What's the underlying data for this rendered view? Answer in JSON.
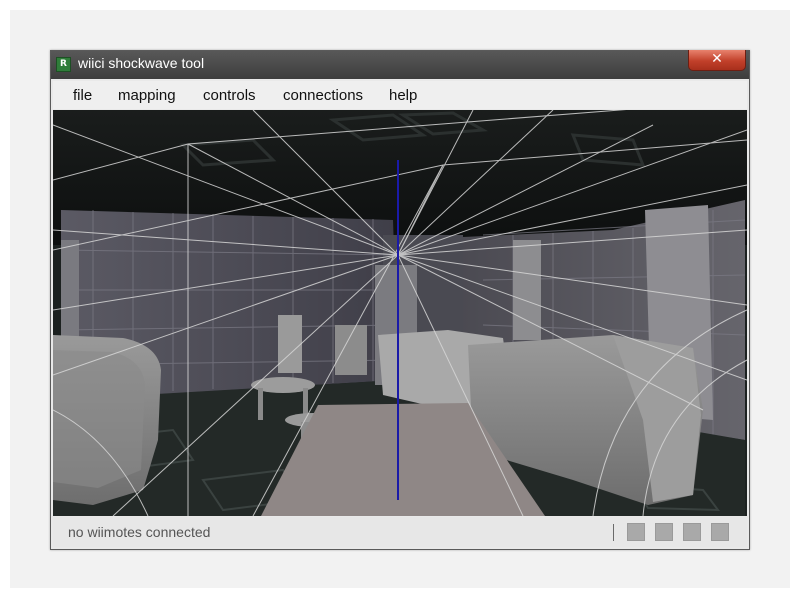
{
  "window": {
    "title": "wiici shockwave tool",
    "close_glyph": "✕",
    "icon": "app-icon"
  },
  "menu": {
    "items": [
      {
        "label": "file"
      },
      {
        "label": "mapping"
      },
      {
        "label": "controls"
      },
      {
        "label": "connections"
      },
      {
        "label": "help"
      }
    ]
  },
  "viewport": {
    "description_icon": "3d-scene"
  },
  "status": {
    "text": "no wiimotes connected",
    "indicators": [
      "wiimote-1",
      "wiimote-2",
      "wiimote-3",
      "wiimote-4"
    ],
    "indicator_color": "#a9a9a9"
  },
  "colors": {
    "titlebar": "#484848",
    "close_button": "#c1402a",
    "axis_line": "#1a1aa8",
    "floor_path": "#8f8786"
  }
}
